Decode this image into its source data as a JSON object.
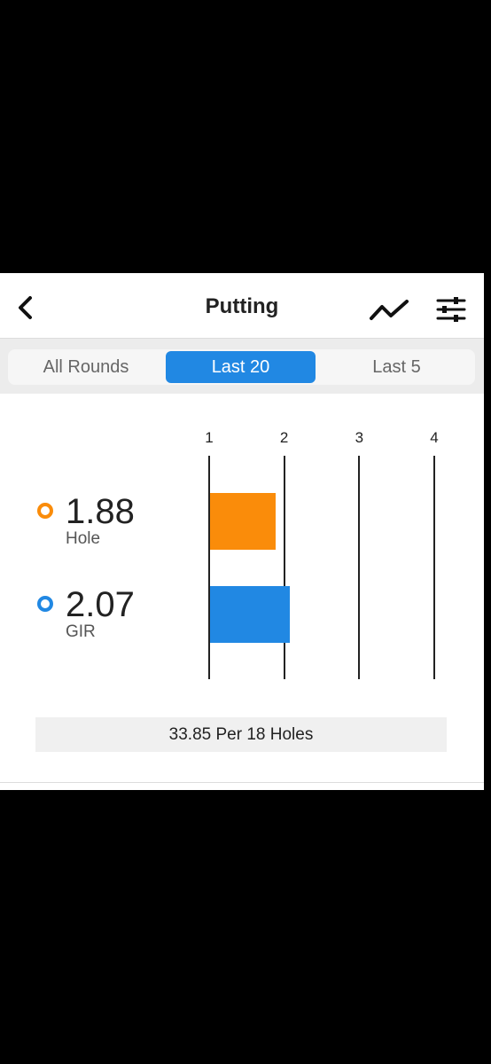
{
  "header": {
    "title": "Putting",
    "back_icon": "chevron-left-icon",
    "trend_icon": "trend-line-icon",
    "filter_icon": "sliders-icon"
  },
  "tabs": [
    {
      "label": "All Rounds",
      "active": false
    },
    {
      "label": "Last 20",
      "active": true
    },
    {
      "label": "Last 5",
      "active": false
    }
  ],
  "colors": {
    "accent": "#2188e3",
    "hole": "#fa8c0a",
    "gir": "#2188e3"
  },
  "stats": [
    {
      "value": "1.88",
      "label": "Hole",
      "color": "#fa8c0a"
    },
    {
      "value": "2.07",
      "label": "GIR",
      "color": "#2188e3"
    }
  ],
  "chart_data": {
    "type": "bar",
    "orientation": "horizontal",
    "categories": [
      "Hole",
      "GIR"
    ],
    "values": [
      1.88,
      2.07
    ],
    "xlim": [
      1,
      4
    ],
    "ticks": [
      "1",
      "2",
      "3",
      "4"
    ],
    "grid": true
  },
  "summary": "33.85 Per 18 Holes"
}
